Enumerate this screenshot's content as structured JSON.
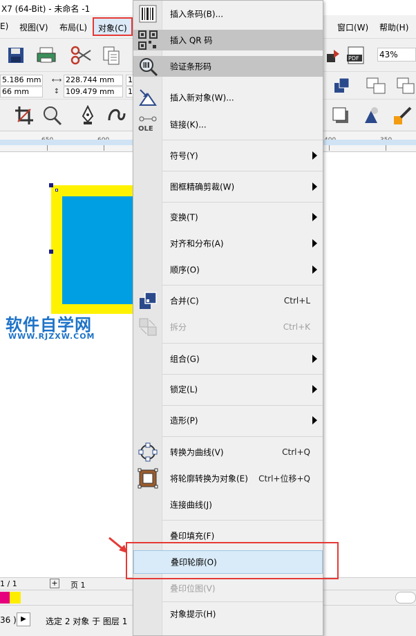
{
  "window": {
    "title": "X7 (64-Bit) - 未命名 -1"
  },
  "menubar": {
    "items": [
      {
        "key": "edit",
        "label": "E)"
      },
      {
        "key": "view",
        "label": "视图(V)"
      },
      {
        "key": "layout",
        "label": "布局(L)"
      },
      {
        "key": "object",
        "label": "对象(C)"
      },
      {
        "key": "window",
        "label": "窗口(W)"
      },
      {
        "key": "help",
        "label": "帮助(H)"
      }
    ]
  },
  "toolbar": {
    "zoom": "43%",
    "pos_x": "5.186 mm",
    "pos_y": "66 mm",
    "width": "228.744 mm",
    "height": "109.479 mm",
    "field_extra_1": "1",
    "field_extra_2": "1"
  },
  "ruler": {
    "ticks": [
      "650",
      "600",
      "400",
      "350"
    ]
  },
  "watermark": {
    "cn": "软件自学网",
    "en": "WWW.RJZXW.COM"
  },
  "pagebar": {
    "page_count": "1 / 1",
    "page_tab": "页 1"
  },
  "status": {
    "left": "36 )",
    "message": "选定 2 对象 于 图层 1"
  },
  "colors": {
    "accent_red": "#e53935",
    "fill_blue": "#009fe3",
    "outline_yellow": "#fff200",
    "swatch_magenta": "#e6007e",
    "swatch_yellow": "#ffed00"
  },
  "object_menu": {
    "items": [
      {
        "label": "插入条码(B)...",
        "icon": "barcode-icon"
      },
      {
        "label": "插入 QR 码",
        "icon": "qr-code-icon"
      },
      {
        "label": "验证条形码",
        "icon": "magnifier-icon"
      },
      {
        "label": "插入新对象(W)...",
        "icon": "insert-object-icon"
      },
      {
        "label": "链接(K)...",
        "icon": "ole-link-icon"
      },
      {
        "label": "符号(Y)"
      },
      {
        "label": "图框精确剪裁(W)"
      },
      {
        "label": "变换(T)"
      },
      {
        "label": "对齐和分布(A)"
      },
      {
        "label": "顺序(O)"
      },
      {
        "label": "合并(C)",
        "shortcut": "Ctrl+L",
        "icon": "combine-icon"
      },
      {
        "label": "拆分",
        "shortcut": "Ctrl+K",
        "icon": "break-apart-icon"
      },
      {
        "label": "组合(G)"
      },
      {
        "label": "锁定(L)"
      },
      {
        "label": "造形(P)"
      },
      {
        "label": "转换为曲线(V)",
        "shortcut": "Ctrl+Q",
        "icon": "convert-to-curves-icon"
      },
      {
        "label": "将轮廓转换为对象(E)",
        "shortcut": "Ctrl+位移+Q",
        "icon": "outline-to-object-icon"
      },
      {
        "label": "连接曲线(J)"
      },
      {
        "label": "叠印填充(F)"
      },
      {
        "label": "叠印轮廓(O)"
      },
      {
        "label": "叠印位图(V)"
      },
      {
        "label": "对象提示(H)"
      }
    ]
  }
}
